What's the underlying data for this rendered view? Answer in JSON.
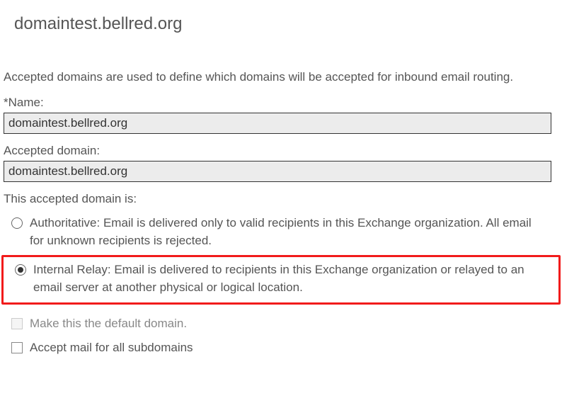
{
  "header": {
    "title": "domaintest.bellred.org"
  },
  "description": "Accepted domains are used to define which domains will be accepted for inbound email routing.",
  "fields": {
    "name": {
      "label": "*Name:",
      "value": "domaintest.bellred.org"
    },
    "accepted_domain": {
      "label": "Accepted domain:",
      "value": "domaintest.bellred.org"
    }
  },
  "domain_type": {
    "heading": "This accepted domain is:",
    "options": {
      "authoritative": {
        "label": "Authoritative: Email is delivered only to valid recipients in this Exchange organization. All email for unknown recipients is rejected.",
        "checked": false
      },
      "internal_relay": {
        "label": "Internal Relay: Email is delivered to recipients in this Exchange organization or relayed to an email server at another physical or logical location.",
        "checked": true
      }
    }
  },
  "checkboxes": {
    "default_domain": {
      "label": "Make this the default domain.",
      "checked": false,
      "disabled": true
    },
    "subdomains": {
      "label": "Accept mail for all subdomains",
      "checked": false,
      "disabled": false
    }
  }
}
